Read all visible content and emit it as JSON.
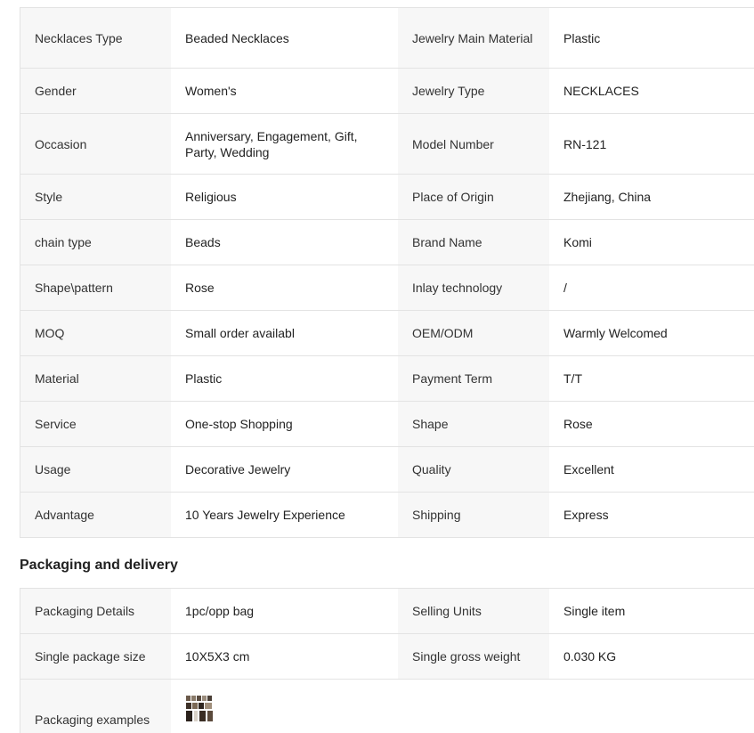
{
  "attributes": [
    {
      "k1": "Necklaces Type",
      "v1": "Beaded Necklaces",
      "k2": "Jewelry Main Material",
      "v2": "Plastic"
    },
    {
      "k1": "Gender",
      "v1": "Women's",
      "k2": "Jewelry Type",
      "v2": "NECKLACES"
    },
    {
      "k1": "Occasion",
      "v1": "Anniversary, Engagement, Gift, Party, Wedding",
      "k2": "Model Number",
      "v2": "RN-121"
    },
    {
      "k1": "Style",
      "v1": "Religious",
      "k2": "Place of Origin",
      "v2": "Zhejiang, China"
    },
    {
      "k1": "chain type",
      "v1": "Beads",
      "k2": "Brand Name",
      "v2": "Komi"
    },
    {
      "k1": "Shape\\pattern",
      "v1": "Rose",
      "k2": "Inlay technology",
      "v2": "/"
    },
    {
      "k1": "MOQ",
      "v1": "Small order availabl",
      "k2": "OEM/ODM",
      "v2": "Warmly Welcomed"
    },
    {
      "k1": "Material",
      "v1": "Plastic",
      "k2": "Payment Term",
      "v2": "T/T"
    },
    {
      "k1": "Service",
      "v1": "One-stop Shopping",
      "k2": "Shape",
      "v2": "Rose"
    },
    {
      "k1": "Usage",
      "v1": "Decorative Jewelry",
      "k2": "Quality",
      "v2": "Excellent"
    },
    {
      "k1": "Advantage",
      "v1": "10 Years Jewelry Experience",
      "k2": "Shipping",
      "v2": "Express"
    }
  ],
  "packaging": {
    "title": "Packaging and delivery",
    "rows": [
      {
        "k1": "Packaging Details",
        "v1": "1pc/opp bag",
        "k2": "Selling Units",
        "v2": "Single item"
      },
      {
        "k1": "Single package size",
        "v1": "10X5X3 cm",
        "k2": "Single gross weight",
        "v2": "0.030 KG"
      }
    ],
    "examples_label": "Packaging examples"
  }
}
